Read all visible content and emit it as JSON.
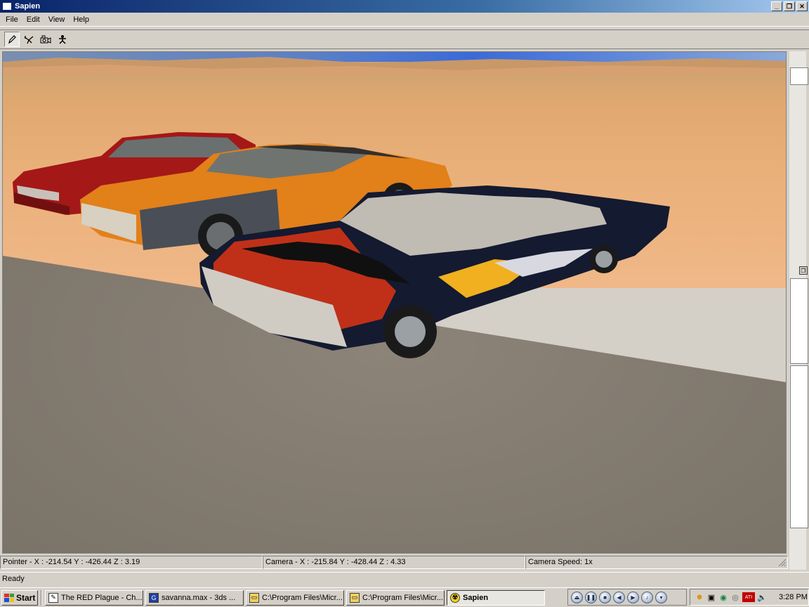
{
  "window": {
    "title": "Sapien",
    "minimize": "_",
    "restore": "❐",
    "close": "✕"
  },
  "menu": [
    "File",
    "Edit",
    "View",
    "Help"
  ],
  "toolbar": {
    "tools": [
      "pencil-icon",
      "cut-tool-icon",
      "camera-icon",
      "figure-icon"
    ]
  },
  "status": {
    "pointer": "Pointer - X : -214.54  Y : -426.44  Z : 3.19",
    "camera": "Camera - X : -215.84  Y : -428.44  Z : 4.33",
    "speed": "Camera Speed: 1x",
    "ready": "Ready"
  },
  "taskbar": {
    "start": "Start",
    "tasks": [
      {
        "label": "The RED Plague - Ch...",
        "icon": "document-icon"
      },
      {
        "label": "savanna.max - 3ds ...",
        "icon": "max-icon"
      },
      {
        "label": "C:\\Program Files\\Micr...",
        "icon": "folder-icon"
      },
      {
        "label": "C:\\Program Files\\Micr...",
        "icon": "folder-icon"
      },
      {
        "label": "Sapien",
        "icon": "radiation-icon"
      }
    ],
    "clock": "3:28 PM"
  },
  "colors": {
    "titlebar": "#0a246a",
    "desert": "#eab07a",
    "ground": "#857d72"
  }
}
